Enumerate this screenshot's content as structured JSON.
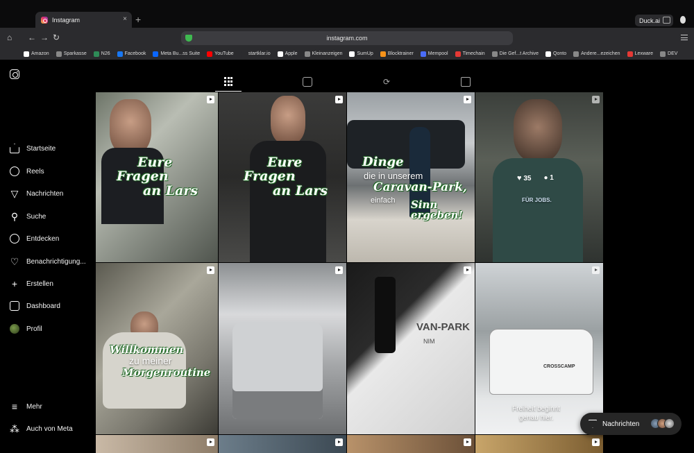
{
  "browser": {
    "tab_title": "Instagram",
    "tab_close": "×",
    "new_tab": "+",
    "duck_label": "Duck.ai",
    "url": "instagram.com",
    "bookmarks": [
      {
        "label": "Amazon",
        "color": "#ffffff"
      },
      {
        "label": "Sparkasse",
        "color": "#888888"
      },
      {
        "label": "N26",
        "color": "#2e8b57"
      },
      {
        "label": "Facebook",
        "color": "#1877f2"
      },
      {
        "label": "Meta Bu...ss Suite",
        "color": "#0a66ff"
      },
      {
        "label": "YouTube",
        "color": "#ff0000"
      },
      {
        "label": "startklar.io",
        "color": "#2b2b2e"
      },
      {
        "label": "Apple",
        "color": "#ffffff"
      },
      {
        "label": "Kleinanzeigen",
        "color": "#888888"
      },
      {
        "label": "SumUp",
        "color": "#ffffff"
      },
      {
        "label": "Blocktrainer",
        "color": "#f7931a"
      },
      {
        "label": "Mempool",
        "color": "#4a6cf7"
      },
      {
        "label": "Timechain",
        "color": "#e53935"
      },
      {
        "label": "Die Gef...t Archive",
        "color": "#888888"
      },
      {
        "label": "Qonto",
        "color": "#ffffff"
      },
      {
        "label": "Andere...ezeichen",
        "color": "#888888"
      },
      {
        "label": "Lexware",
        "color": "#e53935"
      },
      {
        "label": "DEV",
        "color": "#888888"
      }
    ]
  },
  "nav": {
    "items": [
      {
        "label": "Startseite",
        "icon": "home-icon"
      },
      {
        "label": "Reels",
        "icon": "reels-icon"
      },
      {
        "label": "Nachrichten",
        "icon": "send-icon"
      },
      {
        "label": "Suche",
        "icon": "search-icon"
      },
      {
        "label": "Entdecken",
        "icon": "compass-icon"
      },
      {
        "label": "Benachrichtigung...",
        "icon": "heart-icon"
      },
      {
        "label": "Erstellen",
        "icon": "plus-icon"
      },
      {
        "label": "Dashboard",
        "icon": "chart-icon"
      },
      {
        "label": "Profil",
        "icon": "profile-avatar"
      }
    ],
    "more": "Mehr",
    "meta": "Auch von Meta"
  },
  "posts": {
    "p1_line1": "Eure",
    "p1_line2": "Fragen",
    "p1_line3": "an Lars",
    "p2_line1": "Eure",
    "p2_line2": "Fragen",
    "p2_line3": "an Lars",
    "p3_line1": "Dinge",
    "p3_line2": "die in unserem",
    "p3_line3": "Caravan-Park,",
    "p3_line4": "einfach",
    "p3_line5": "Sinn ergeben!",
    "p4_likes": "35",
    "p4_comments": "1",
    "p4_shirt": "FÜR JOBS.",
    "p5_line1": "Willkommen",
    "p5_line2": "zu meiner",
    "p5_line3": "Morgenroutine",
    "p7_sign": "VAN-PARK",
    "p7_sign2": "NIM",
    "p8_brand": "CROSSCAMP",
    "p8_line1": "Freiheit beginnt",
    "p8_line2": "genau hier."
  },
  "messages": {
    "label": "Nachrichten"
  },
  "colors": {
    "accent": "#ffffff",
    "background": "#000000",
    "script_green": "#2e7d32"
  }
}
